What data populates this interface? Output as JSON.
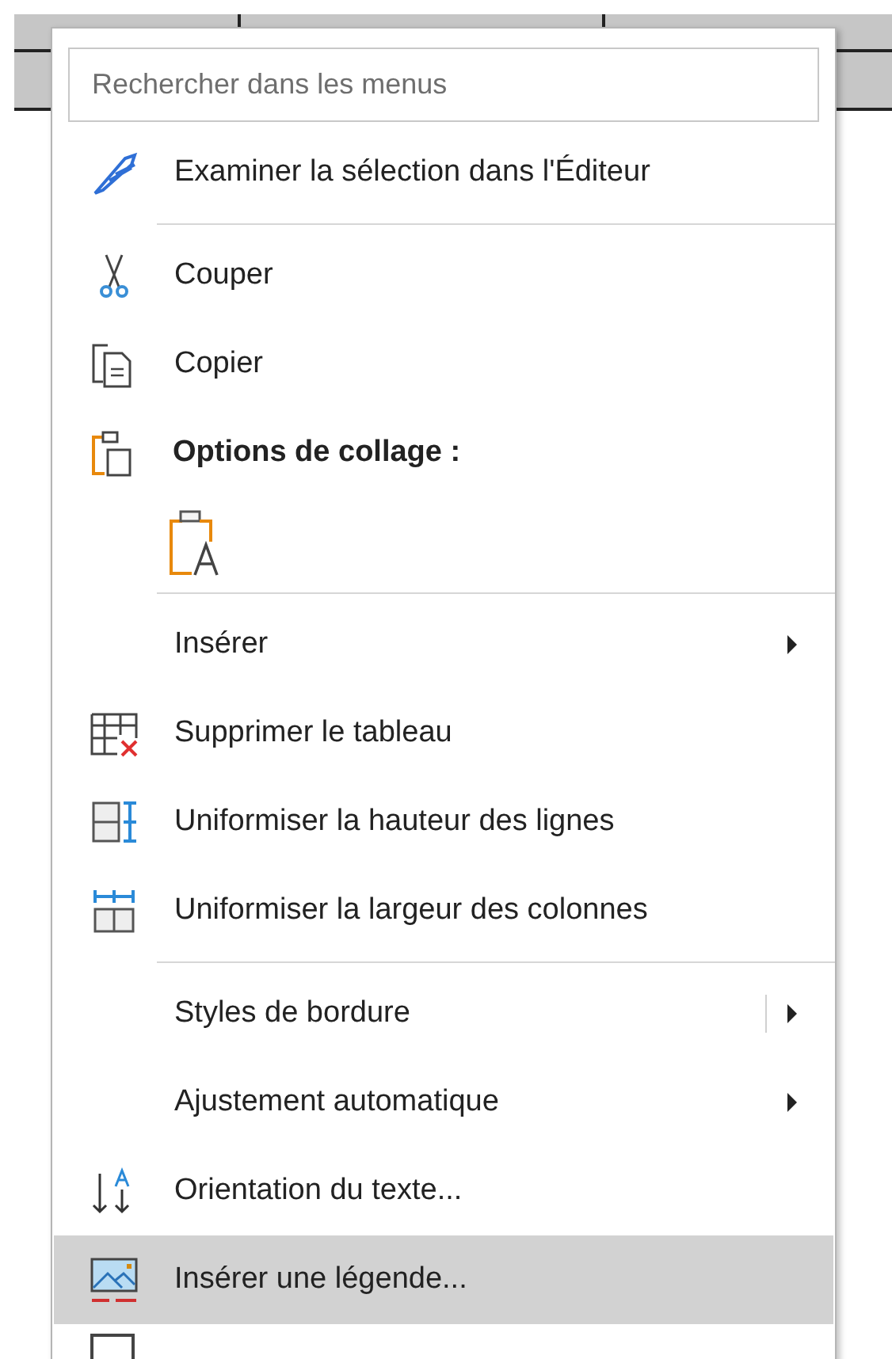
{
  "search": {
    "placeholder": "Rechercher dans les menus"
  },
  "items": [
    {
      "kind": "item",
      "label": "Examiner la sélection dans l'Éditeur",
      "submenu": false,
      "selected": false
    },
    {
      "kind": "separator"
    },
    {
      "kind": "item",
      "label": "Couper",
      "submenu": false,
      "selected": false
    },
    {
      "kind": "item",
      "label": "Copier",
      "submenu": false,
      "selected": false
    },
    {
      "kind": "header",
      "label": "Options de collage :"
    },
    {
      "kind": "paste_options"
    },
    {
      "kind": "separator"
    },
    {
      "kind": "item",
      "label": "Insérer",
      "submenu": true,
      "selected": false
    },
    {
      "kind": "item",
      "label": "Supprimer le tableau",
      "submenu": false,
      "selected": false
    },
    {
      "kind": "item",
      "label": "Uniformiser la hauteur des lignes",
      "submenu": false,
      "selected": false
    },
    {
      "kind": "item",
      "label": "Uniformiser la largeur des colonnes",
      "submenu": false,
      "selected": false
    },
    {
      "kind": "separator"
    },
    {
      "kind": "item",
      "label": "Styles de bordure",
      "submenu": true,
      "split": true,
      "selected": false
    },
    {
      "kind": "item",
      "label": "Ajustement automatique",
      "submenu": true,
      "selected": false
    },
    {
      "kind": "item",
      "label": "Orientation du texte...",
      "submenu": false,
      "selected": false
    },
    {
      "kind": "item",
      "label": "Insérer une légende...",
      "submenu": false,
      "selected": true
    }
  ]
}
